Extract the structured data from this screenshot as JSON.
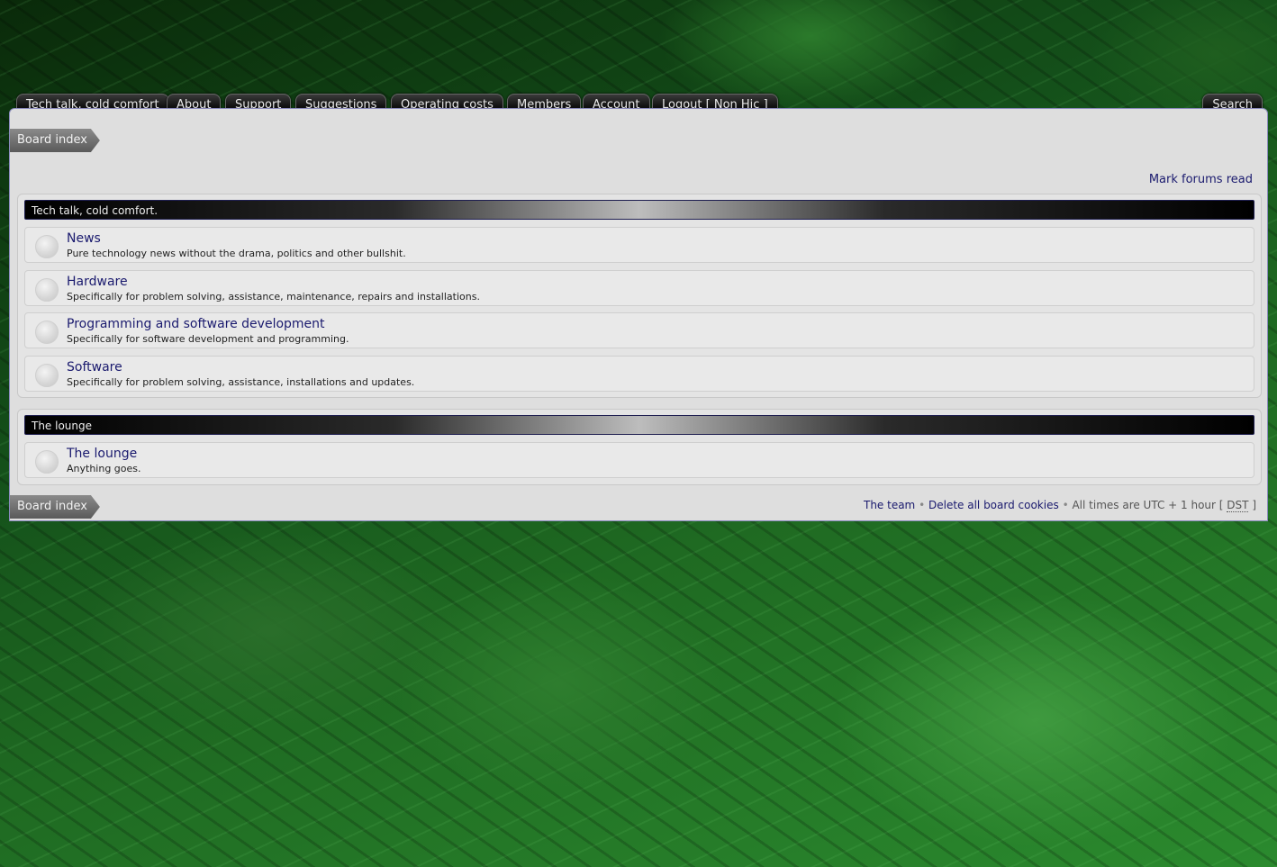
{
  "nav": {
    "tabs": [
      "Tech talk, cold comfort",
      "About",
      "Support",
      "Suggestions",
      "Operating costs",
      "Members",
      "Account",
      "Logout [ Non Hic ]"
    ],
    "search": "Search"
  },
  "breadcrumb": {
    "top": "Board index",
    "bottom": "Board index"
  },
  "mark_forums_read": "Mark forums read",
  "categories": [
    {
      "title": "Tech talk, cold comfort.",
      "forums": [
        {
          "name": "News",
          "desc": "Pure technology news without the drama, politics and other bullshit."
        },
        {
          "name": "Hardware",
          "desc": "Specifically for problem solving, assistance, maintenance, repairs and installations."
        },
        {
          "name": "Programming and software development",
          "desc": "Specifically for software development and programming."
        },
        {
          "name": "Software",
          "desc": "Specifically for problem solving, assistance, installations and updates."
        }
      ]
    },
    {
      "title": "The lounge",
      "forums": [
        {
          "name": "The lounge",
          "desc": "Anything goes."
        }
      ]
    }
  ],
  "footer": {
    "team": "The team",
    "bullet": "•",
    "delete_cookies": "Delete all board cookies",
    "times_prefix": "All times are UTC + 1 hour [",
    "dst": "DST",
    "times_suffix": "]"
  },
  "colors": {
    "link": "#1a1a6e",
    "panel": "#dedede",
    "background": "#1f6a22"
  }
}
